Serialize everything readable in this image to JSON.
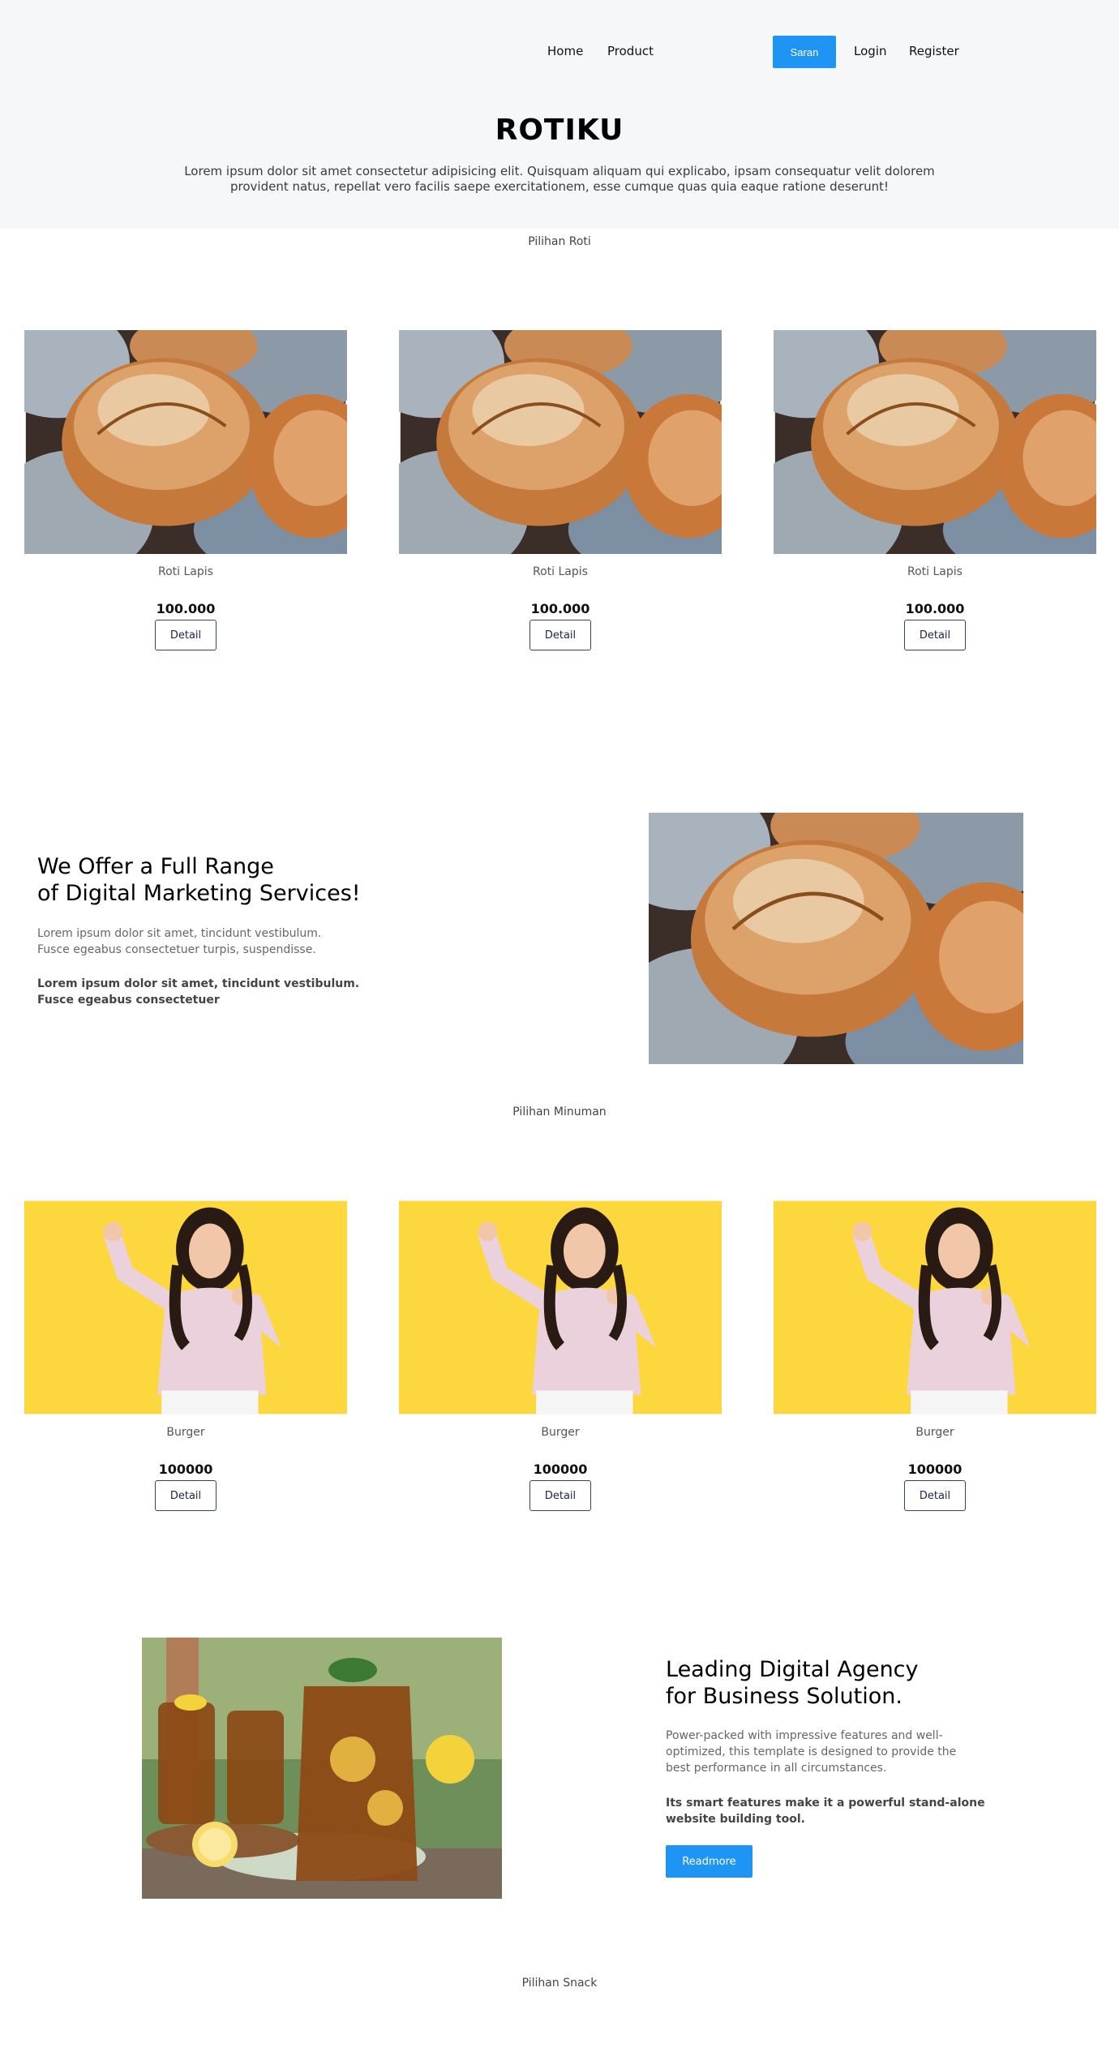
{
  "nav": {
    "home": "Home",
    "product": "Product",
    "saran": "Saran",
    "login": "Login",
    "register": "Register"
  },
  "hero": {
    "title": "ROTIKU",
    "description": "Lorem ipsum dolor sit amet consectetur adipisicing elit. Quisquam aliquam qui explicabo, ipsam consequatur velit dolorem provident natus, repellat vero facilis saepe exercitationem, esse cumque quas quia eaque ratione deserunt!"
  },
  "sections": {
    "roti": "Pilihan Roti",
    "minuman": "Pilihan Minuman",
    "snack": "Pilihan Snack"
  },
  "roti_cards": [
    {
      "name": "Roti Lapis",
      "price": "100.000",
      "button": "Detail"
    },
    {
      "name": "Roti Lapis",
      "price": "100.000",
      "button": "Detail"
    },
    {
      "name": "Roti Lapis",
      "price": "100.000",
      "button": "Detail"
    }
  ],
  "feature1": {
    "heading_line1": "We Offer a Full Range",
    "heading_line2": "of Digital Marketing Services!",
    "text_line1": "Lorem ipsum dolor sit amet, tincidunt vestibulum.",
    "text_line2": "Fusce egeabus consectetuer turpis, suspendisse.",
    "bold_line1": "Lorem ipsum dolor sit amet, tincidunt vestibulum.",
    "bold_line2": "Fusce egeabus consectetuer"
  },
  "minuman_cards": [
    {
      "name": "Burger",
      "price": "100000",
      "button": "Detail"
    },
    {
      "name": "Burger",
      "price": "100000",
      "button": "Detail"
    },
    {
      "name": "Burger",
      "price": "100000",
      "button": "Detail"
    }
  ],
  "feature2": {
    "heading_line1": "Leading Digital Agency",
    "heading_line2": "for Business Solution.",
    "text_line1": "Power-packed with impressive features and well-",
    "text_line2": "optimized, this template is designed to provide the",
    "text_line3": "best performance in all circumstances.",
    "bold_line1": "Its smart features make it a powerful stand-alone",
    "bold_line2": "website building tool.",
    "button": "Readmore"
  },
  "colors": {
    "accent": "#1e95f5",
    "hero_bg": "#f6f7f9",
    "button_border": "#37426b"
  }
}
